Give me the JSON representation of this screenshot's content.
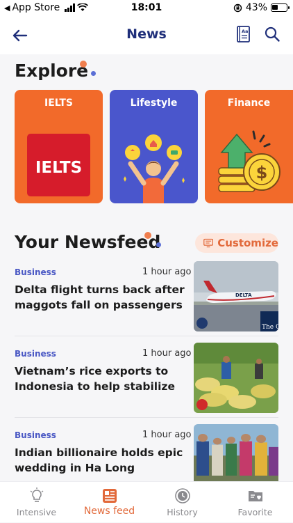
{
  "status_bar": {
    "carrier": "App Store",
    "time": "18:01",
    "battery": "43%",
    "battery_level": 0.43
  },
  "navbar": {
    "title": "News",
    "icons": [
      "back-arrow-icon",
      "dictionary-icon",
      "search-icon"
    ]
  },
  "explore": {
    "title": "Explore",
    "categories": [
      {
        "label": "IELTS",
        "color": "#f26a2a",
        "logo_text": "IELTS"
      },
      {
        "label": "Lifestyle",
        "color": "#4a56cc"
      },
      {
        "label": "Finance",
        "color": "#f26a2a"
      }
    ]
  },
  "newsfeed": {
    "title": "Your Newsfeed",
    "customize_label": "Customize",
    "items": [
      {
        "category": "Business",
        "time": "1 hour ago",
        "headline": "Delta flight turns back after maggots fall on passengers fr...",
        "thumb_text": "The Guar"
      },
      {
        "category": "Business",
        "time": "1 hour ago",
        "headline": "Vietnam’s rice exports to Indonesia to help stabilize pric..."
      },
      {
        "category": "Business",
        "time": "1 hour ago",
        "headline": "Indian billionaire holds epic wedding in Ha Long"
      }
    ]
  },
  "tabbar": {
    "tabs": [
      {
        "label": "Intensive",
        "icon": "lightbulb-icon"
      },
      {
        "label": "News feed",
        "icon": "newsfeed-icon",
        "active": true
      },
      {
        "label": "History",
        "icon": "history-icon"
      },
      {
        "label": "Favorite",
        "icon": "favorite-folder-icon"
      }
    ]
  },
  "colors": {
    "accent": "#e2693a",
    "brand_blue": "#1f2f7a",
    "category_blue": "#4a58c4"
  }
}
